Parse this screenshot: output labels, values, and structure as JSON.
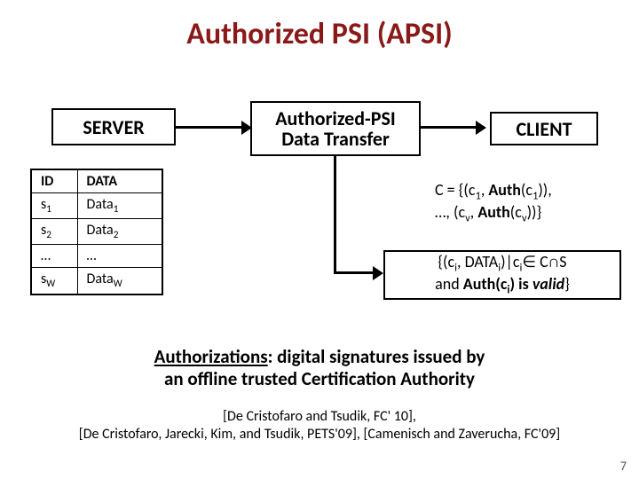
{
  "title": "Authorized PSI (APSI)",
  "server_label": "SERVER",
  "apsi_label_l1": "Authorized-PSI",
  "apsi_label_l2": "Data Transfer",
  "client_label": "CLIENT",
  "table": {
    "head_id": "ID",
    "head_data": "DATA",
    "rows": [
      {
        "id": "s",
        "idSub": "1",
        "data": "Data",
        "dataSub": "1"
      },
      {
        "id": "s",
        "idSub": "2",
        "data": "Data",
        "dataSub": "2"
      },
      {
        "id": "…",
        "idSub": "",
        "data": "…",
        "dataSub": ""
      },
      {
        "id": "s",
        "idSub": "W",
        "data": "Data",
        "dataSub": "W"
      }
    ]
  },
  "client_set_html": "C = {(c<sub>1</sub>, <b>Auth</b>(c<sub>1</sub>)),<br>…, (c<sub>v</sub>, <b>Auth</b>(c<sub>v</sub>))}",
  "result_html": "{(c<sub>i</sub>, DATA<sub>i</sub>)|c<sub>i</sub>&isin; C&cap;S<br>and <b>Auth(c<sub>i</sub>) is <i>valid</i></b>}",
  "caption_html": "<span class=\"ul\">Authorizations</span>: digital signatures issued by<br>an offline trusted Certification Authority",
  "refs_l1": "[De Cristofaro and Tsudik, FC' 10],",
  "refs_l2": "[De Cristofaro, Jarecki, Kim, and Tsudik, PETS'09], [Camenisch and Zaverucha, FC'09]",
  "page": "7"
}
